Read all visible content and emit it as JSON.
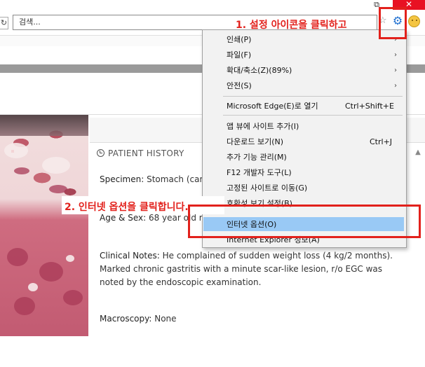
{
  "window": {
    "restore_glyph": "⧉",
    "close_glyph": "✕"
  },
  "address_bar": {
    "refresh_glyph": "↻",
    "search_placeholder": "검색..."
  },
  "toolbar": {
    "favorite_icon": "star-icon",
    "settings_icon": "gear-icon",
    "feedback_icon": "smiley-icon"
  },
  "patient_history": {
    "title": "PATIENT HISTORY",
    "specimen_label": "Specimen:",
    "specimen_value": "Stomach (card",
    "age_sex_label": "Age & Sex:",
    "age_sex_value": "68 year old ma",
    "clinical_label": "Clinical Notes:",
    "clinical_value": "He complained of sudden weight loss (4 kg/2 months). Marked chronic gastritis with a minute scar-like lesion, r/o EGC was noted by the endoscopic examination.",
    "macroscopy_label": "Macroscopy:",
    "macroscopy_value": "None"
  },
  "menu": {
    "items": [
      {
        "label": "인쇄(P)",
        "submenu": true
      },
      {
        "label": "파일(F)",
        "submenu": true
      },
      {
        "label": "확대/축소(Z)(89%)",
        "submenu": true
      },
      {
        "label": "안전(S)",
        "submenu": true
      },
      {
        "label": "Microsoft Edge(E)로 열기",
        "shortcut": "Ctrl+Shift+E"
      },
      {
        "label": "앱 뷰에 사이트 추가(I)"
      },
      {
        "label": "다운로드 보기(N)",
        "shortcut": "Ctrl+J"
      },
      {
        "label": "추가 기능 관리(M)"
      },
      {
        "label": "F12 개발자 도구(L)"
      },
      {
        "label": "고정된 사이트로 이동(G)"
      },
      {
        "label": "호환성 보기 설정(B)"
      },
      {
        "label": "인터넷 옵션(O)",
        "highlighted": true
      },
      {
        "label": "Internet Explorer 정보(A)"
      }
    ],
    "arrow_glyph": "›"
  },
  "annotations": {
    "step1": "1. 설정 아이콘을 클릭하고",
    "step2": "2. 인터넷 옵션을 클릭합니다.",
    "color": "#e2211c"
  },
  "colors": {
    "highlight": "#99c9f5",
    "close": "#e81123",
    "gear": "#1e6fd0"
  }
}
